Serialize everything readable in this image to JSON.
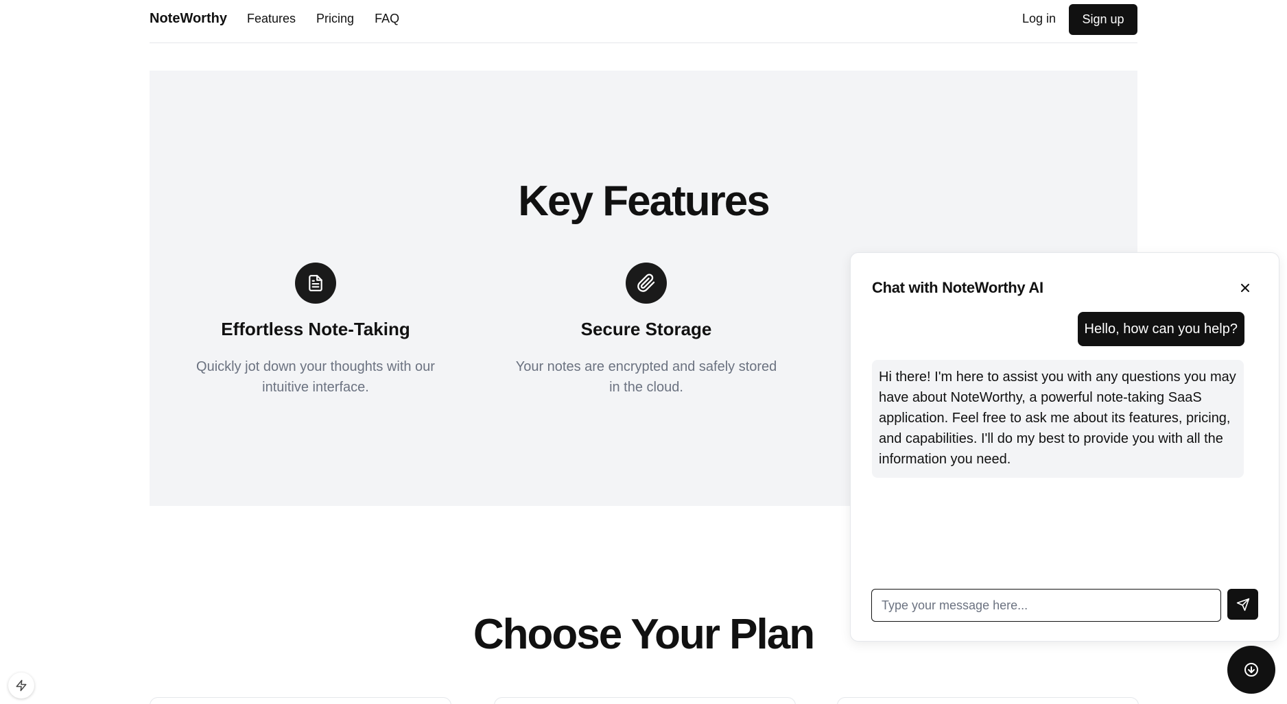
{
  "header": {
    "brand": "NoteWorthy",
    "nav": [
      "Features",
      "Pricing",
      "FAQ"
    ],
    "login_label": "Log in",
    "signup_label": "Sign up"
  },
  "features": {
    "title": "Key Features",
    "items": [
      {
        "icon": "document-icon",
        "title": "Effortless Note-Taking",
        "description": "Quickly jot down your thoughts with our intuitive interface."
      },
      {
        "icon": "paperclip-icon",
        "title": "Secure Storage",
        "description": "Your notes are encrypted and safely stored in the cloud."
      }
    ]
  },
  "pricing": {
    "title": "Choose Your Plan"
  },
  "chat": {
    "title": "Chat with NoteWorthy AI",
    "user_message": "Hello, how can you help?",
    "ai_message": "Hi there! I'm here to assist you with any questions you may have about NoteWorthy, a powerful note-taking SaaS application. Feel free to ask me about its features, pricing, and capabilities. I'll do my best to provide you with all the information you need.",
    "input_placeholder": "Type your message here...",
    "input_value": ""
  },
  "colors": {
    "primary": "#111111",
    "section_bg": "#f3f4f6",
    "muted_text": "#6b7280"
  }
}
